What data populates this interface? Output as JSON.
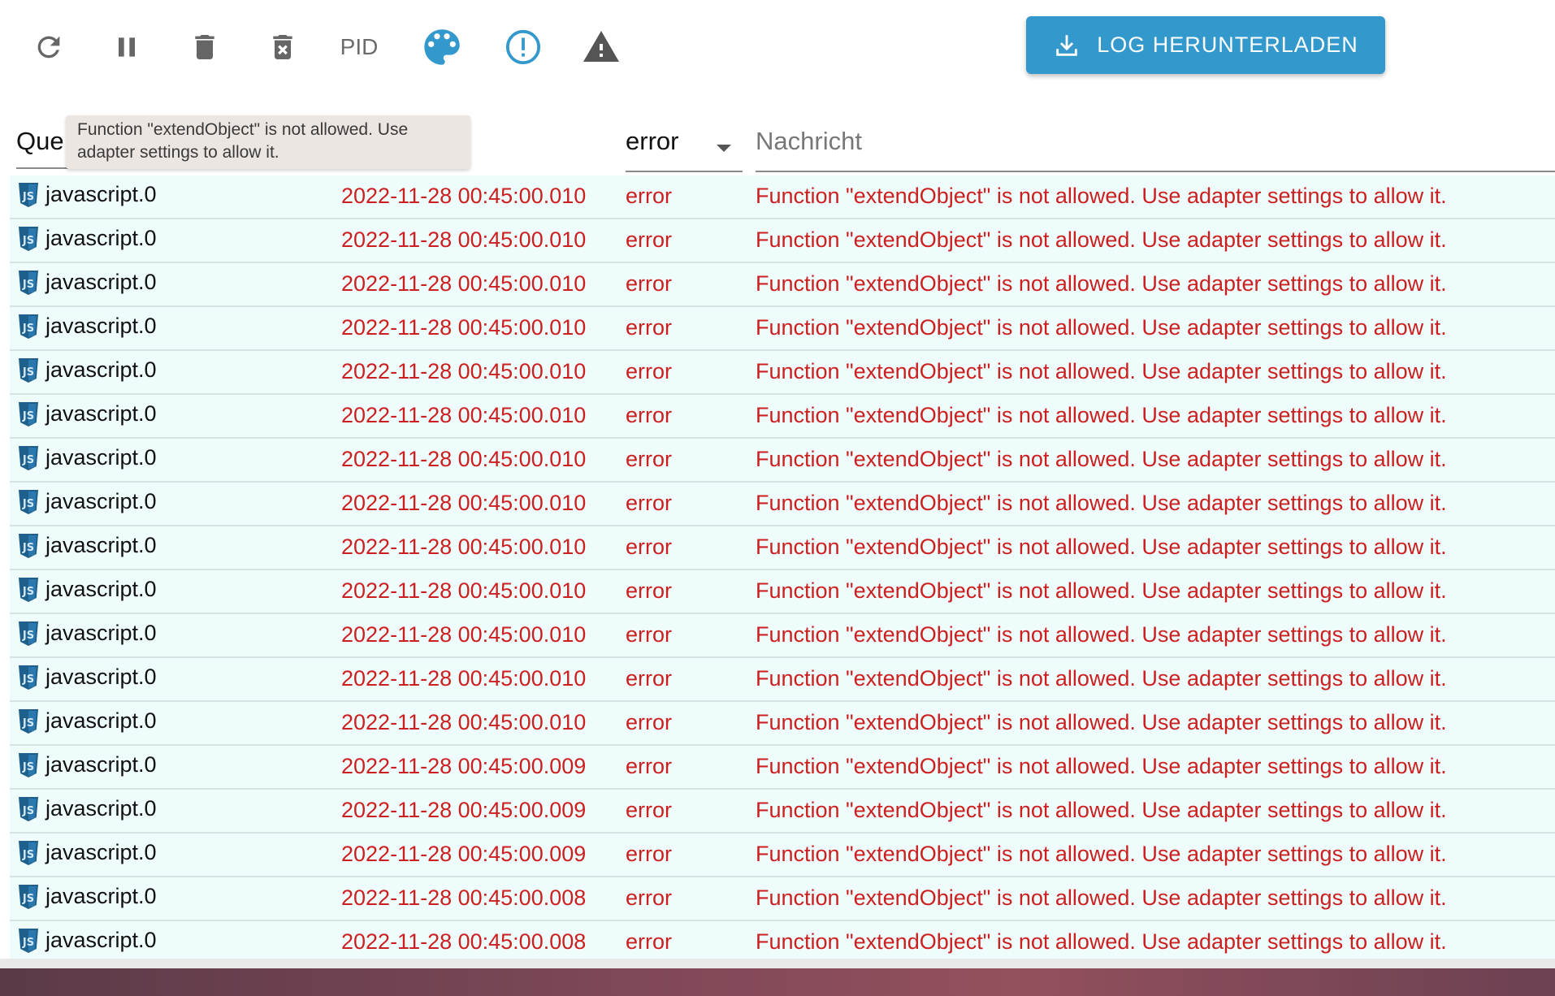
{
  "toolbar": {
    "icons": {
      "refresh": "refresh-icon",
      "pause": "pause-icon",
      "delete": "trash-icon",
      "clear": "trash-x-icon",
      "palette": "palette-icon",
      "info": "alert-circle-icon",
      "warning": "warning-icon"
    },
    "pid_label": "PID",
    "download_label": "LOG HERUNTERLADEN",
    "colors": {
      "icon_gray": "#666666",
      "accent_blue": "#3399cc"
    }
  },
  "header": {
    "source_label": "Que",
    "severity_value": "error",
    "message_placeholder": "Nachricht"
  },
  "tooltip": {
    "text": "Function \"extendObject\" is not allowed. Use adapter settings to allow it."
  },
  "logs": {
    "error_color": "#cc1f1f",
    "row_bg": "#eefcfc",
    "rows": [
      {
        "source": "javascript.0",
        "time": "2022-11-28 00:45:00.010",
        "severity": "error",
        "message": "Function \"extendObject\" is not allowed. Use adapter settings to allow it."
      },
      {
        "source": "javascript.0",
        "time": "2022-11-28 00:45:00.010",
        "severity": "error",
        "message": "Function \"extendObject\" is not allowed. Use adapter settings to allow it."
      },
      {
        "source": "javascript.0",
        "time": "2022-11-28 00:45:00.010",
        "severity": "error",
        "message": "Function \"extendObject\" is not allowed. Use adapter settings to allow it."
      },
      {
        "source": "javascript.0",
        "time": "2022-11-28 00:45:00.010",
        "severity": "error",
        "message": "Function \"extendObject\" is not allowed. Use adapter settings to allow it."
      },
      {
        "source": "javascript.0",
        "time": "2022-11-28 00:45:00.010",
        "severity": "error",
        "message": "Function \"extendObject\" is not allowed. Use adapter settings to allow it."
      },
      {
        "source": "javascript.0",
        "time": "2022-11-28 00:45:00.010",
        "severity": "error",
        "message": "Function \"extendObject\" is not allowed. Use adapter settings to allow it."
      },
      {
        "source": "javascript.0",
        "time": "2022-11-28 00:45:00.010",
        "severity": "error",
        "message": "Function \"extendObject\" is not allowed. Use adapter settings to allow it."
      },
      {
        "source": "javascript.0",
        "time": "2022-11-28 00:45:00.010",
        "severity": "error",
        "message": "Function \"extendObject\" is not allowed. Use adapter settings to allow it."
      },
      {
        "source": "javascript.0",
        "time": "2022-11-28 00:45:00.010",
        "severity": "error",
        "message": "Function \"extendObject\" is not allowed. Use adapter settings to allow it."
      },
      {
        "source": "javascript.0",
        "time": "2022-11-28 00:45:00.010",
        "severity": "error",
        "message": "Function \"extendObject\" is not allowed. Use adapter settings to allow it."
      },
      {
        "source": "javascript.0",
        "time": "2022-11-28 00:45:00.010",
        "severity": "error",
        "message": "Function \"extendObject\" is not allowed. Use adapter settings to allow it."
      },
      {
        "source": "javascript.0",
        "time": "2022-11-28 00:45:00.010",
        "severity": "error",
        "message": "Function \"extendObject\" is not allowed. Use adapter settings to allow it."
      },
      {
        "source": "javascript.0",
        "time": "2022-11-28 00:45:00.010",
        "severity": "error",
        "message": "Function \"extendObject\" is not allowed. Use adapter settings to allow it."
      },
      {
        "source": "javascript.0",
        "time": "2022-11-28 00:45:00.009",
        "severity": "error",
        "message": "Function \"extendObject\" is not allowed. Use adapter settings to allow it."
      },
      {
        "source": "javascript.0",
        "time": "2022-11-28 00:45:00.009",
        "severity": "error",
        "message": "Function \"extendObject\" is not allowed. Use adapter settings to allow it."
      },
      {
        "source": "javascript.0",
        "time": "2022-11-28 00:45:00.009",
        "severity": "error",
        "message": "Function \"extendObject\" is not allowed. Use adapter settings to allow it."
      },
      {
        "source": "javascript.0",
        "time": "2022-11-28 00:45:00.008",
        "severity": "error",
        "message": "Function \"extendObject\" is not allowed. Use adapter settings to allow it."
      },
      {
        "source": "javascript.0",
        "time": "2022-11-28 00:45:00.008",
        "severity": "error",
        "message": "Function \"extendObject\" is not allowed. Use adapter settings to allow it."
      }
    ]
  }
}
